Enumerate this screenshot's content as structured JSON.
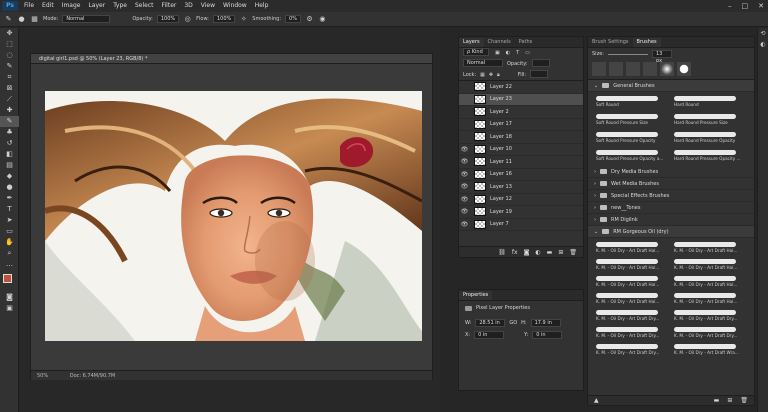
{
  "app": {
    "logo": "Ps"
  },
  "menu": [
    "File",
    "Edit",
    "Image",
    "Layer",
    "Type",
    "Select",
    "Filter",
    "3D",
    "View",
    "Window",
    "Help"
  ],
  "window_controls": [
    "–",
    "□",
    "✕"
  ],
  "options": {
    "mode_label": "Mode:",
    "mode_value": "Normal",
    "opacity_label": "Opacity:",
    "opacity_value": "100%",
    "flow_label": "Flow:",
    "flow_value": "100%",
    "smoothing_label": "Smoothing:",
    "smoothing_value": "0%"
  },
  "document": {
    "tab_title": "digital girl1.psd @ 50% (Layer 23, RGB/8) *",
    "zoom": "50%",
    "doc_info": "Doc: 6.74M/90.7M"
  },
  "layers_panel": {
    "tabs": [
      "Layers",
      "Channels",
      "Paths"
    ],
    "filter_label": "ρ Kind",
    "blend_mode": "Normal",
    "opacity_label": "Opacity:",
    "lock_label": "Lock:",
    "fill_label": "Fill:",
    "layers": [
      {
        "name": "Layer 22",
        "visible": false,
        "selected": false
      },
      {
        "name": "Layer 23",
        "visible": false,
        "selected": true
      },
      {
        "name": "Layer 2",
        "visible": false,
        "selected": false
      },
      {
        "name": "Layer 17",
        "visible": false,
        "selected": false
      },
      {
        "name": "Layer 18",
        "visible": false,
        "selected": false
      },
      {
        "name": "Layer 10",
        "visible": true,
        "selected": false
      },
      {
        "name": "Layer 11",
        "visible": true,
        "selected": false
      },
      {
        "name": "Layer 16",
        "visible": true,
        "selected": false
      },
      {
        "name": "Layer 13",
        "visible": true,
        "selected": false
      },
      {
        "name": "Layer 12",
        "visible": true,
        "selected": false
      },
      {
        "name": "Layer 19",
        "visible": true,
        "selected": false
      },
      {
        "name": "Layer 7",
        "visible": true,
        "selected": false
      }
    ]
  },
  "properties_panel": {
    "title": "Properties",
    "subtitle": "Pixel Layer Properties",
    "w_label": "W:",
    "w_value": "28.51 in",
    "go_label": "GO",
    "h_label": "H:",
    "h_value": "17.9 in",
    "x_label": "X:",
    "x_value": "0 in",
    "y_label": "Y:",
    "y_value": "0 in"
  },
  "brushes_panel": {
    "tabs": [
      "Brush Settings",
      "Brushes"
    ],
    "size_label": "Size:",
    "size_value": "13 px",
    "groups": [
      "General Brushes",
      "Dry Media Brushes",
      "Wet Media Brushes",
      "Special Effects Brushes",
      "new__Tones",
      "RM DigiInk",
      "RM Gorgeous Oil (dry)"
    ],
    "general_brushes": [
      "Soft Round",
      "Hard Round",
      "Soft Round Pressure Size",
      "Hard Round Pressure Size",
      "Soft Round Pressure Opacity",
      "Hard Round Pressure Opacity",
      "Soft Round Pressure Opacity a...",
      "Hard Round Pressure Opacity ..."
    ],
    "oil_brushes": [
      "K. M. - Oil Dry - Art Draft Hal...",
      "K. M. - Oil Dry - Art Draft Hal...",
      "K. M. - Oil Dry - Art Draft Hal...",
      "K. M. - Oil Dry - Art Draft Hal...",
      "K. M. - Oil Dry - Art Draft Hal...",
      "K. M. - Oil Dry - Art Draft Hal...",
      "K. M. - Oil Dry - Art Draft Hal...",
      "K. M. - Oil Dry - Art Draft Hal...",
      "K. M. - Oil Dry - Art Draft Dry...",
      "K. M. - Oil Dry - Art Draft Dry...",
      "K. M. - Oil Dry - Art Draft Dry...",
      "K. M. - Oil Dry - Art Draft Dry...",
      "K. M. - Oil Dry - Art Draft Dry...",
      "K. M. - Oil Dry - Art Draft Wra..."
    ]
  },
  "colors": {
    "foreground": "#c0513a",
    "background": "#ffffff",
    "accent": "#31a8ff"
  }
}
